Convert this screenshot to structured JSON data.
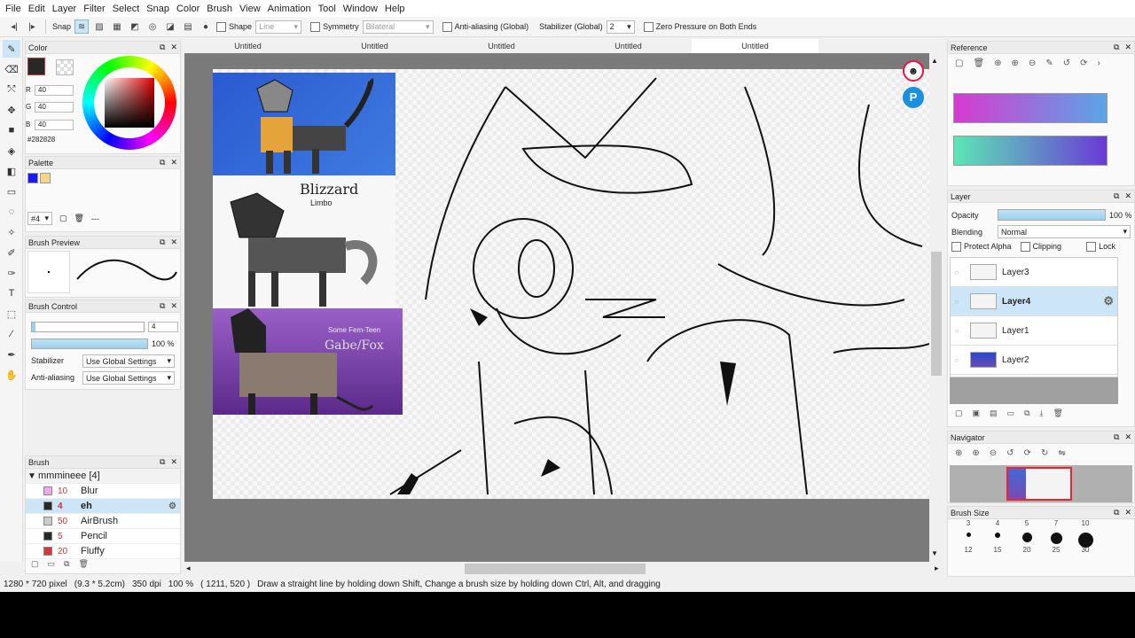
{
  "menu": [
    "File",
    "Edit",
    "Layer",
    "Filter",
    "Select",
    "Snap",
    "Color",
    "Brush",
    "View",
    "Animation",
    "Tool",
    "Window",
    "Help"
  ],
  "toolbar": {
    "snap_label": "Snap",
    "shape_label": "Shape",
    "shape_value": "Line",
    "symmetry_label": "Symmetry",
    "symmetry_value": "Bilateral",
    "antialias_label": "Anti-aliasing (Global)",
    "stabilizer_label": "Stabilizer (Global)",
    "stabilizer_value": "2",
    "zero_pressure_label": "Zero Pressure on Both Ends"
  },
  "tabs": [
    "Untitled",
    "Untitled",
    "Untitled",
    "Untitled",
    "Untitled"
  ],
  "color_panel": {
    "title": "Color",
    "r_label": "R",
    "r": "40",
    "g_label": "G",
    "g": "40",
    "b_label": "B",
    "b": "40",
    "hex": "#282828",
    "fg": "#282828"
  },
  "palette_panel": {
    "title": "Palette",
    "sel": "#4",
    "swatches": [
      "#1a1aee",
      "#f5d58a"
    ],
    "dash": "---"
  },
  "brush_preview": {
    "title": "Brush Preview"
  },
  "brush_control": {
    "title": "Brush Control",
    "size": "4",
    "opacity": "100 %",
    "stabilizer_label": "Stabilizer",
    "stabilizer_value": "Use Global Settings",
    "antialias_label": "Anti-aliasing",
    "antialias_value": "Use Global Settings"
  },
  "brush_panel": {
    "title": "Brush",
    "group": "mmmineee [4]",
    "items": [
      {
        "size": "10",
        "name": "Blur",
        "color": "#f4a6e8"
      },
      {
        "size": "4",
        "name": "eh",
        "color": "#282828"
      },
      {
        "size": "50",
        "name": "AirBrush",
        "color": "#cccccc"
      },
      {
        "size": "5",
        "name": "Pencil",
        "color": "#282828"
      },
      {
        "size": "20",
        "name": "Fluffy",
        "color": "#d23a3a"
      }
    ]
  },
  "reference": {
    "title": "Reference",
    "grad1": [
      "#d63ad0",
      "#5aa6e6"
    ],
    "grad2": [
      "#5ce6b4",
      "#6a3ad6"
    ]
  },
  "layer_panel": {
    "title": "Layer",
    "opacity_label": "Opacity",
    "opacity": "100 %",
    "blending_label": "Blending",
    "blending": "Normal",
    "protect_alpha": "Protect Alpha",
    "clipping": "Clipping",
    "lock": "Lock",
    "layers": [
      "Layer3",
      "Layer4",
      "Layer1",
      "Layer2"
    ]
  },
  "navigator": {
    "title": "Navigator"
  },
  "brush_size": {
    "title": "Brush Size",
    "top": [
      "3",
      "4",
      "5",
      "7",
      "10"
    ],
    "bottom": [
      "12",
      "15",
      "20",
      "25",
      "30"
    ]
  },
  "canvas_text": {
    "sig1": "Blizzard",
    "sig2": "Limbo",
    "sig3": "Some Fem-Teen",
    "sig4": "Gabe/Fox"
  },
  "status": {
    "size": "1280 * 720 pixel",
    "cm": "(9.3 * 5.2cm)",
    "dpi": "350 dpi",
    "zoom": "100 %",
    "coord": "( 1211, 520 )",
    "hint": "Draw a straight line by holding down Shift, Change a brush size by holding down Ctrl, Alt, and dragging"
  }
}
